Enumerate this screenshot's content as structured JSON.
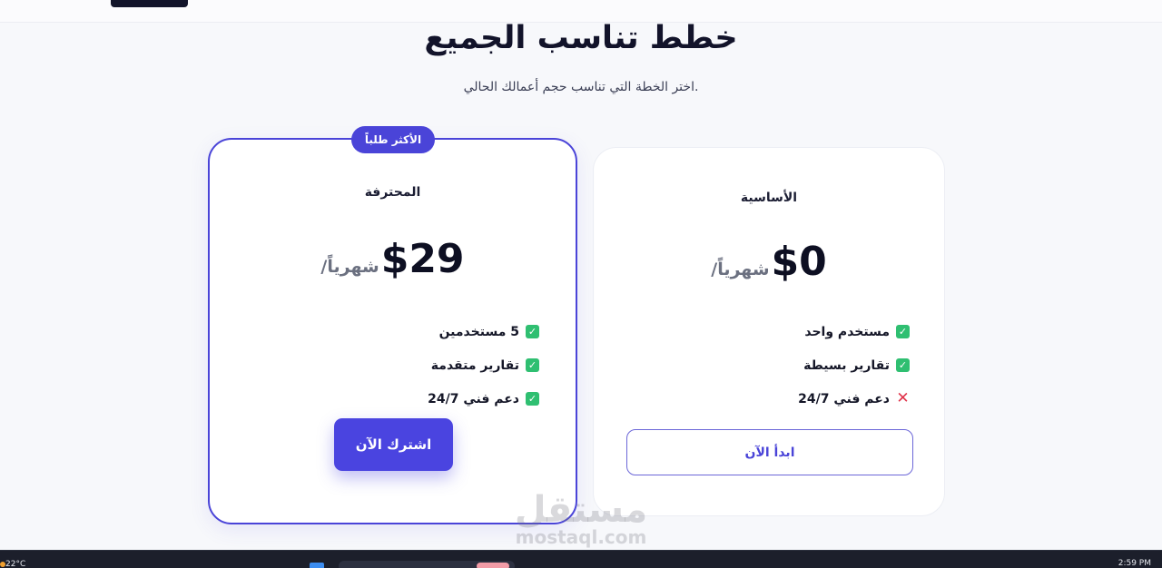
{
  "page": {
    "title": "خطط تناسب الجميع",
    "subtitle": "اختر الخطة التي تناسب حجم أعمالك الحالي."
  },
  "plans": {
    "basic": {
      "name": "الأساسية",
      "price": "$0",
      "period": "/شهرياً",
      "features": [
        {
          "label": "مستخدم واحد",
          "included": true
        },
        {
          "label": "تقارير بسيطة",
          "included": true
        },
        {
          "label": "دعم فني 24/7",
          "included": false
        }
      ],
      "button": "ابدأ الآن"
    },
    "pro": {
      "badge": "الأكثر طلباً",
      "name": "المحترفة",
      "price": "$29",
      "period": "/شهرياً",
      "features": [
        {
          "label": "5 مستخدمين",
          "included": true
        },
        {
          "label": "تقارير متقدمة",
          "included": true
        },
        {
          "label": "دعم فني 24/7",
          "included": true
        }
      ],
      "button": "اشترك الآن"
    }
  },
  "icons": {
    "check": "✓",
    "cross": "✕"
  },
  "watermark": {
    "arabic": "مستقل",
    "latin": "mostaql.com"
  },
  "taskbar": {
    "temperature": "22°C",
    "time": "2:59 PM"
  },
  "colors": {
    "accent": "#4a44d8",
    "check": "#2fbf71",
    "cross": "#e0334a"
  }
}
